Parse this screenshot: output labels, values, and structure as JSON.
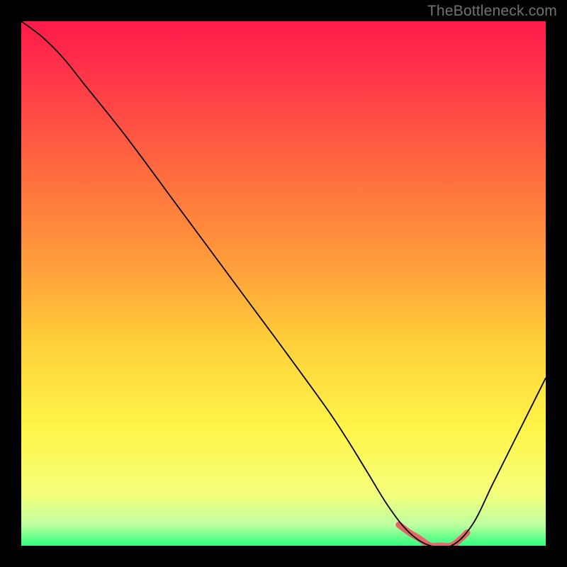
{
  "watermark": "TheBottleneck.com",
  "chart_data": {
    "type": "line",
    "title": "",
    "xlabel": "",
    "ylabel": "",
    "xlim": [
      0,
      100
    ],
    "ylim": [
      0,
      100
    ],
    "series": [
      {
        "name": "bottleneck-curve",
        "x": [
          0,
          4,
          8,
          12,
          20,
          30,
          40,
          50,
          58,
          62,
          66,
          70,
          74,
          78,
          82,
          86,
          90,
          94,
          98,
          100
        ],
        "values": [
          100,
          97,
          93,
          88,
          78,
          64.5,
          51,
          37.5,
          26.5,
          20.5,
          14,
          7.5,
          2.5,
          0,
          0,
          4,
          12,
          20,
          28,
          32
        ]
      }
    ],
    "highlight_range": {
      "name": "optimal-zone",
      "x": [
        72,
        74,
        76,
        78,
        80,
        82,
        84,
        85
      ],
      "values": [
        4,
        2.5,
        1.3,
        0,
        0,
        0,
        1.5,
        2.5
      ]
    },
    "gradient_stops": [
      {
        "offset": 0.0,
        "color": "#ff1a4a"
      },
      {
        "offset": 0.12,
        "color": "#ff3a48"
      },
      {
        "offset": 0.3,
        "color": "#ff6f3e"
      },
      {
        "offset": 0.48,
        "color": "#ffa23a"
      },
      {
        "offset": 0.62,
        "color": "#ffd23a"
      },
      {
        "offset": 0.78,
        "color": "#fff54a"
      },
      {
        "offset": 0.9,
        "color": "#f6ff7a"
      },
      {
        "offset": 0.96,
        "color": "#beffa0"
      },
      {
        "offset": 1.0,
        "color": "#2fff7e"
      }
    ],
    "highlight_color": "#e46767"
  }
}
